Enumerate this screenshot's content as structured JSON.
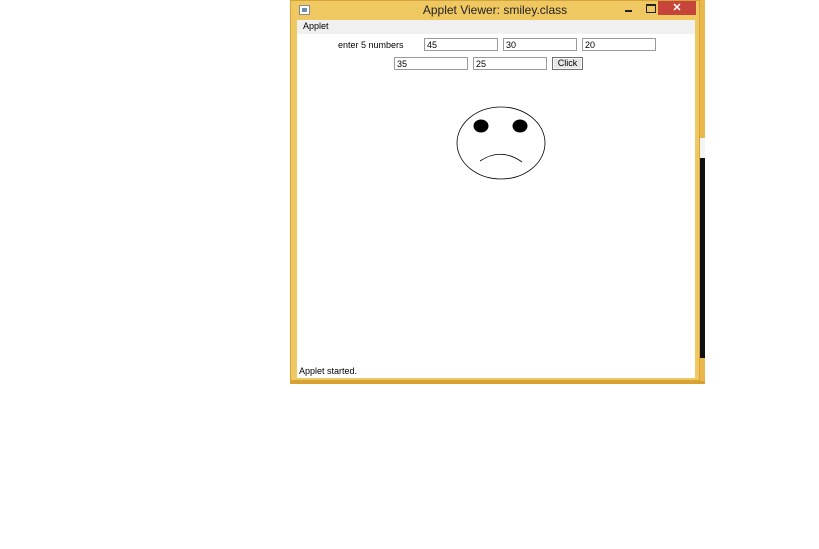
{
  "window": {
    "title": "Applet Viewer: smiley.class",
    "controls": {
      "minimize": "–",
      "maximize": "□",
      "close": "✕"
    },
    "icon": "java-app-icon"
  },
  "menu": {
    "items": [
      "Applet"
    ]
  },
  "form": {
    "label": "enter 5 numbers",
    "values": [
      "45",
      "30",
      "20",
      "35",
      "25"
    ],
    "button_label": "Click"
  },
  "canvas": {
    "drawing": "sad-face",
    "stroke_color": "#000000",
    "fill_color": "#ffffff"
  },
  "status": {
    "text": "Applet started."
  },
  "colors": {
    "frame": "#f0c861",
    "close_button": "#c7443b"
  }
}
